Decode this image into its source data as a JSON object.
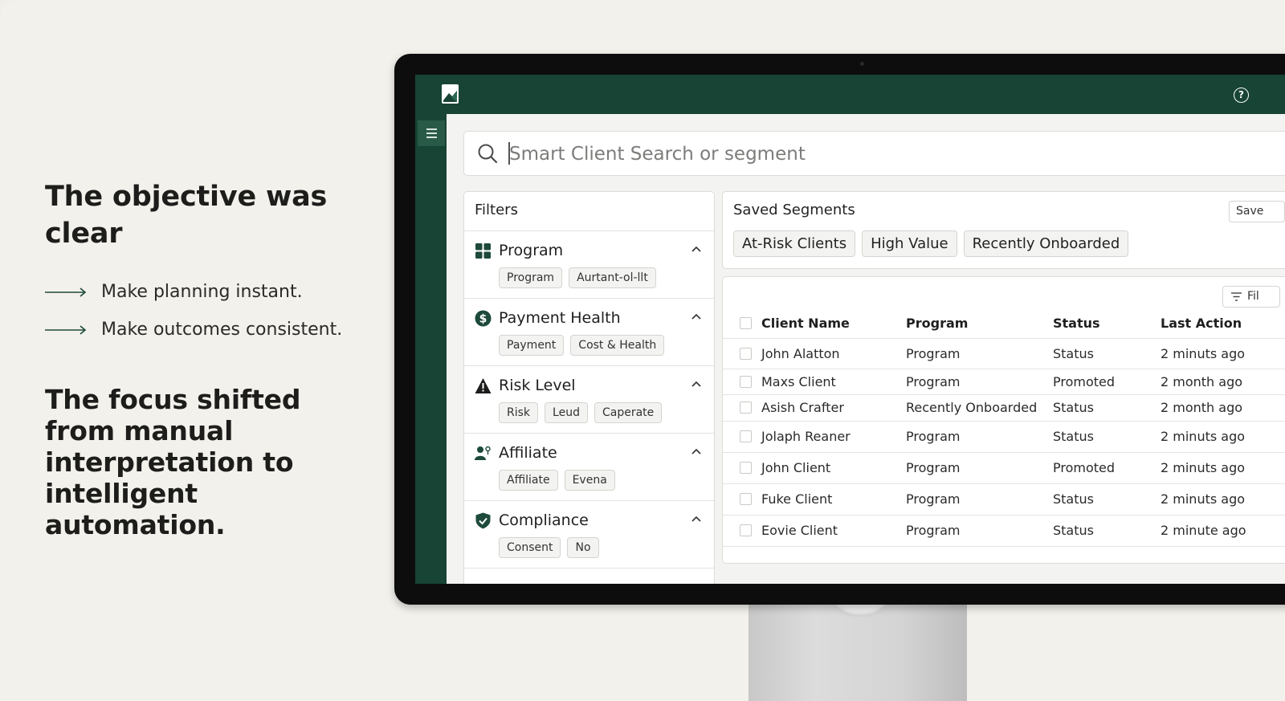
{
  "left": {
    "heading": "The objective was clear",
    "bullets": [
      "Make planning instant.",
      "Make outcomes consistent."
    ],
    "subheading": "The focus shifted from manual interpretation to intelligent automation."
  },
  "app": {
    "search": {
      "placeholder": "Smart Client Search or segment"
    },
    "help_label": "?",
    "filters": {
      "title": "Filters",
      "groups": [
        {
          "title": "Program",
          "icon": "grid-icon",
          "chips": [
            "Program",
            "Aurtant-ol-llt"
          ]
        },
        {
          "title": "Payment Health",
          "icon": "dollar-icon",
          "chips": [
            "Payment",
            "Cost & Health"
          ]
        },
        {
          "title": "Risk Level",
          "icon": "warning-icon",
          "chips": [
            "Risk",
            "Leud",
            "Caperate"
          ]
        },
        {
          "title": "Affiliate",
          "icon": "user-group-icon",
          "chips": [
            "Affiliate",
            "Evena"
          ]
        },
        {
          "title": "Compliance",
          "icon": "shield-check-icon",
          "chips": [
            "Consent",
            "No"
          ]
        }
      ]
    },
    "segments": {
      "title": "Saved Segments",
      "save_label": "Save",
      "chips": [
        "At-Risk Clients",
        "High Value",
        "Recently Onboarded"
      ]
    },
    "table": {
      "filter_label": "Fil",
      "columns": [
        "Client Name",
        "Program",
        "Status",
        "Last Action"
      ],
      "rows": [
        [
          "John Alatton",
          "Program",
          "Status",
          "2 minuts ago"
        ],
        [
          "Maxs Client",
          "Program",
          "Promoted",
          "2 month ago"
        ],
        [
          "Asish Crafter",
          "Recently Onboarded",
          "Status",
          "2 month ago"
        ],
        [
          "Jolaph Reaner",
          "Program",
          "Status",
          "2 minuts ago"
        ],
        [
          "John Client",
          "Program",
          "Promoted",
          "2 minuts ago"
        ],
        [
          "Fuke Client",
          "Program",
          "Status",
          "2 minuts ago"
        ],
        [
          "Eovie Client",
          "Program",
          "Status",
          "2 minute ago"
        ]
      ]
    },
    "colors": {
      "brand": "#174434",
      "background": "#f3f1ec"
    }
  }
}
